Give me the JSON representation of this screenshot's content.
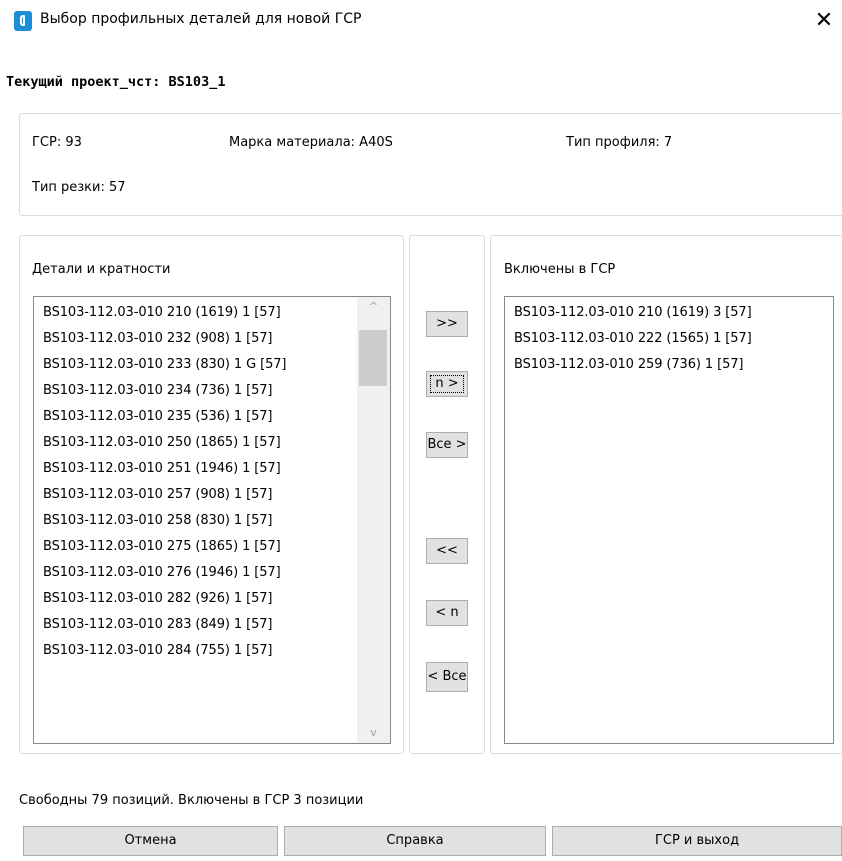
{
  "window": {
    "title": "Выбор профильных деталей для новой ГСР",
    "close_glyph": "✕"
  },
  "project_line": "Текущий проект_чст: BS103_1",
  "info": {
    "gsr": "ГСР: 93",
    "material": "Марка материала: A40S",
    "profile_type": "Тип профиля: 7",
    "cut_type": "Тип резки: 57"
  },
  "left_panel": {
    "label": "Детали и кратности",
    "items": [
      "BS103-112.03-010 210 (1619) 1  [57]",
      "BS103-112.03-010 232 (908) 1  [57]",
      "BS103-112.03-010 233 (830) 1 G [57]",
      "BS103-112.03-010 234 (736) 1  [57]",
      "BS103-112.03-010 235 (536) 1  [57]",
      "BS103-112.03-010 250 (1865) 1  [57]",
      "BS103-112.03-010 251 (1946) 1  [57]",
      "BS103-112.03-010 257 (908) 1  [57]",
      "BS103-112.03-010 258 (830) 1  [57]",
      "BS103-112.03-010 275 (1865) 1  [57]",
      "BS103-112.03-010 276 (1946) 1  [57]",
      "BS103-112.03-010 282 (926) 1  [57]",
      "BS103-112.03-010 283 (849) 1  [57]",
      "BS103-112.03-010 284 (755) 1  [57]"
    ],
    "scroll_up_glyph": "^",
    "scroll_down_glyph": "v"
  },
  "mid_buttons": {
    "add_all": ">>",
    "add_n": "n >",
    "add_every": "Все >",
    "remove_all": "<<",
    "remove_n": "< n",
    "remove_every": "< Все"
  },
  "right_panel": {
    "label": "Включены в ГСР",
    "items": [
      "BS103-112.03-010 210 (1619) 3  [57]",
      "BS103-112.03-010 222 (1565) 1  [57]",
      "BS103-112.03-010 259 (736) 1  [57]"
    ]
  },
  "status": "Свободны 79 позиций. Включены в ГСР 3 позиции",
  "footer": {
    "cancel": "Отмена",
    "help": "Справка",
    "ok": "ГСР и выход"
  }
}
